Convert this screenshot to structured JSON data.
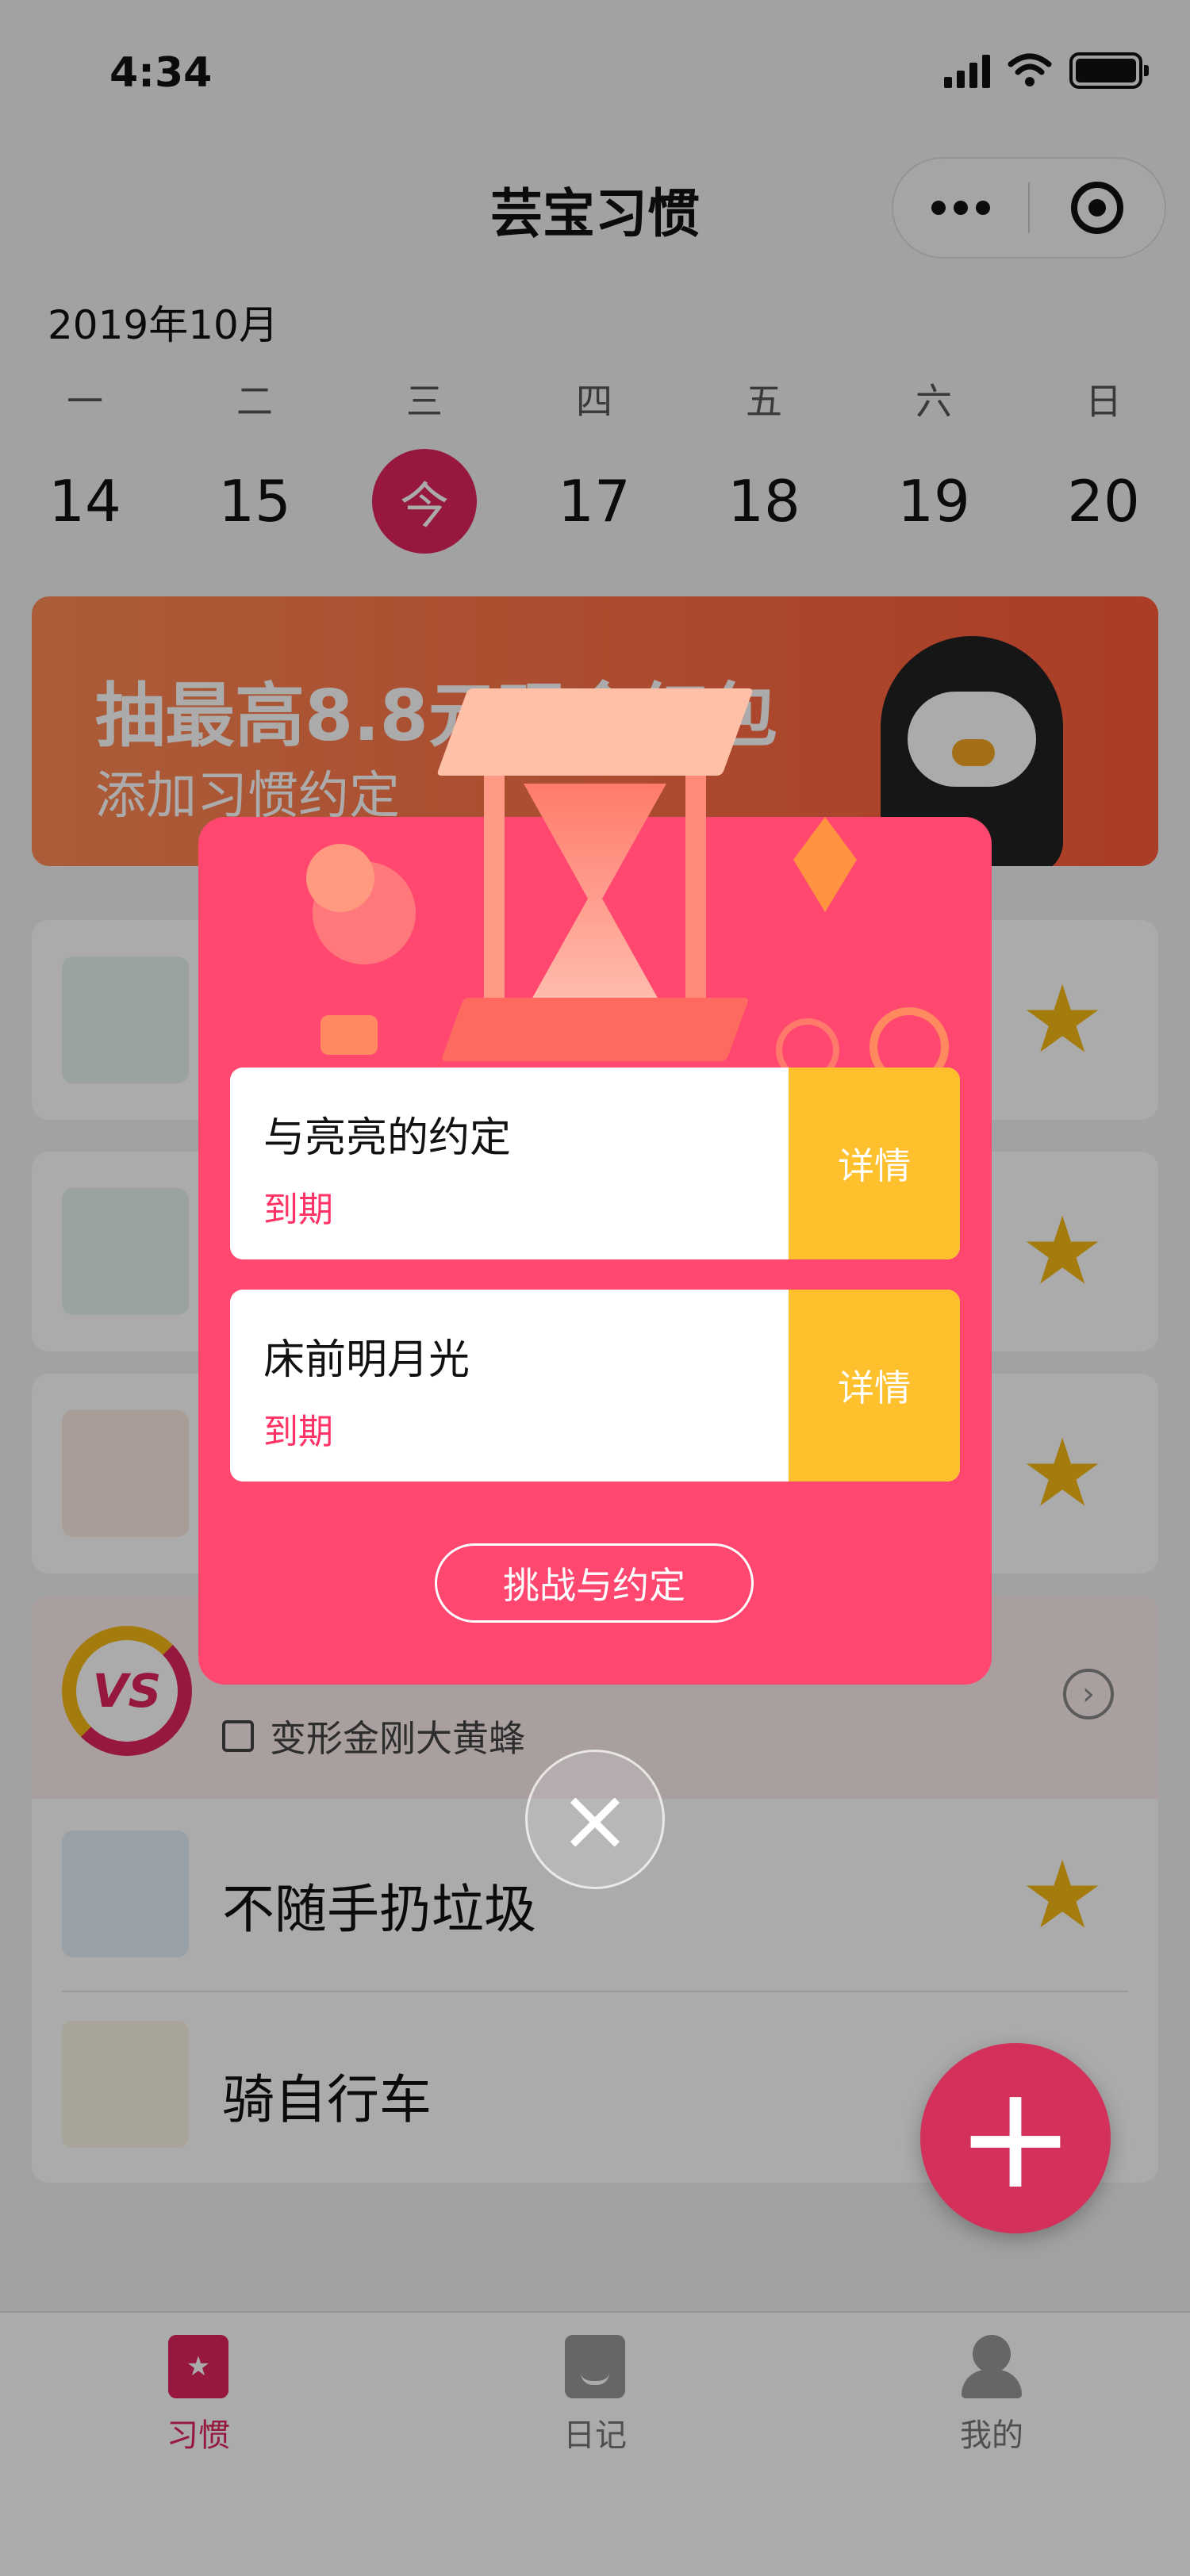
{
  "status_bar": {
    "time": "4:34"
  },
  "nav": {
    "title": "芸宝习惯"
  },
  "calendar": {
    "month": "2019年10月",
    "weekdays": [
      "一",
      "二",
      "三",
      "四",
      "五",
      "六",
      "日"
    ],
    "dates": [
      "14",
      "15",
      "今",
      "17",
      "18",
      "19",
      "20"
    ]
  },
  "banner": {
    "line1": "抽最高8.8元现金红包",
    "line2": "添加习惯约定"
  },
  "habits": [
    {
      "name": "不随手扔垃圾",
      "icon": "trash-bin-icon"
    },
    {
      "name": "骑自行车",
      "icon": "bicycle-icon"
    }
  ],
  "vs_card": {
    "badge": "VS",
    "reward": "变形金刚大黄蜂"
  },
  "modal": {
    "items": [
      {
        "name": "与亮亮的约定",
        "status": "到期",
        "action": "详情"
      },
      {
        "name": "床前明月光",
        "status": "到期",
        "action": "详情"
      }
    ],
    "challenge_button": "挑战与约定"
  },
  "fab": {
    "label": "+"
  },
  "tabbar": {
    "tabs": [
      {
        "label": "习惯"
      },
      {
        "label": "日记"
      },
      {
        "label": "我的"
      }
    ]
  },
  "colors": {
    "accent": "#e0245e",
    "modal": "#ff4770",
    "detail": "#ffc02e",
    "star": "#f5b915"
  }
}
